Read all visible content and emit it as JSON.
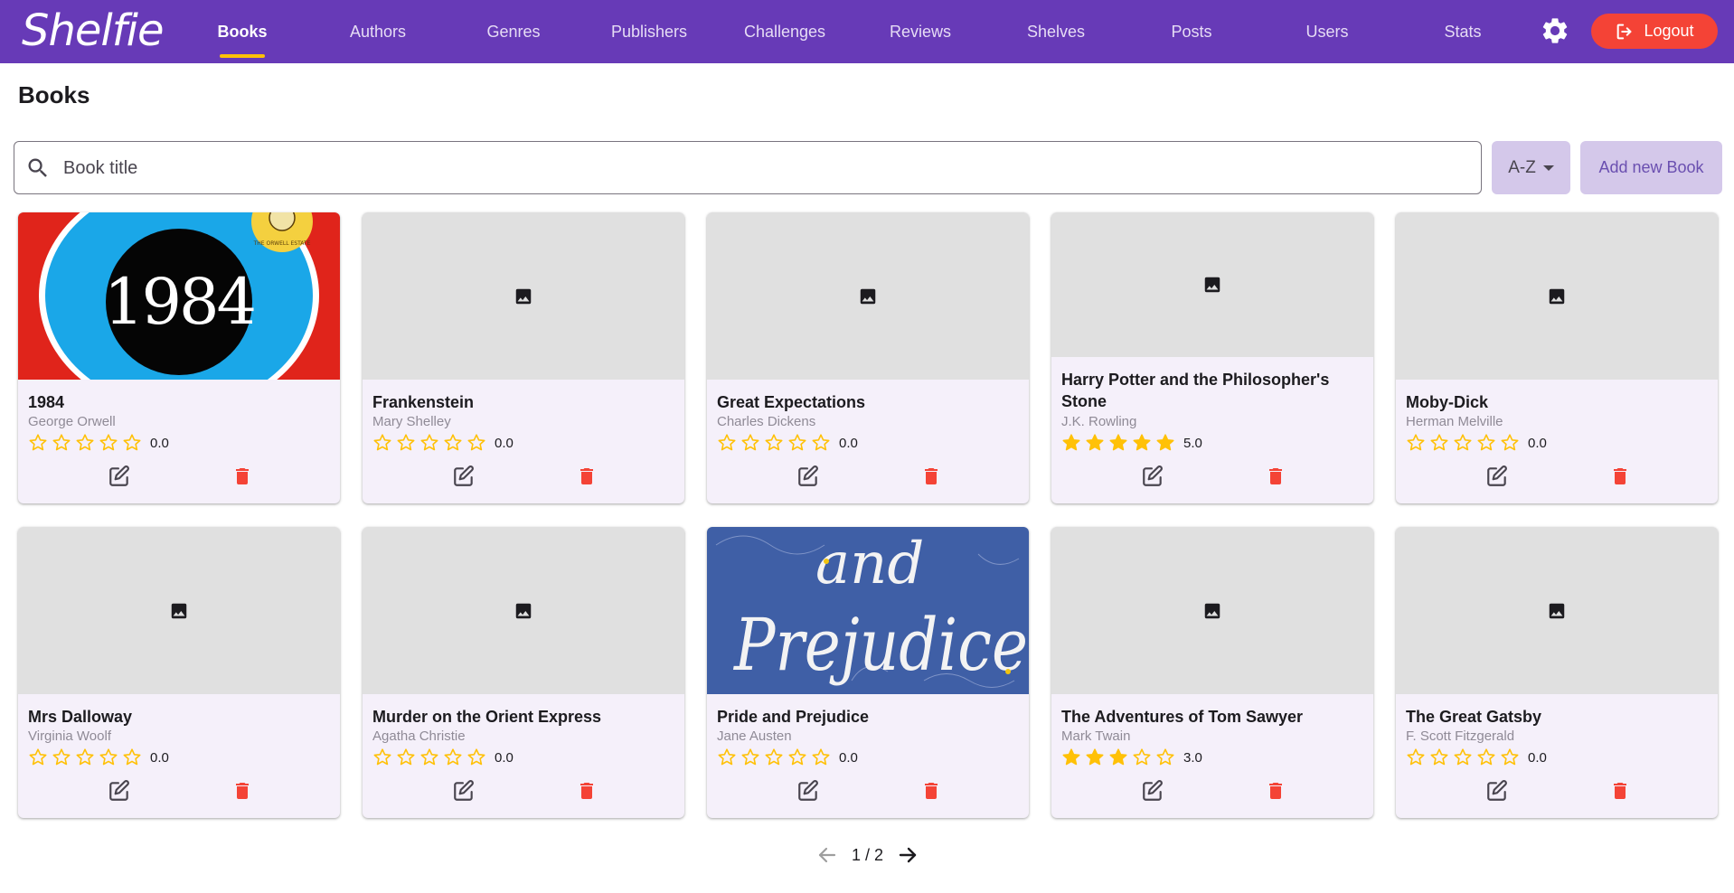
{
  "app": {
    "name": "Shelfie",
    "nav": [
      {
        "label": "Books",
        "active": true
      },
      {
        "label": "Authors",
        "active": false
      },
      {
        "label": "Genres",
        "active": false
      },
      {
        "label": "Publishers",
        "active": false
      },
      {
        "label": "Challenges",
        "active": false
      },
      {
        "label": "Reviews",
        "active": false
      },
      {
        "label": "Shelves",
        "active": false
      },
      {
        "label": "Posts",
        "active": false
      },
      {
        "label": "Users",
        "active": false
      },
      {
        "label": "Stats",
        "active": false
      }
    ],
    "settings_icon": "gear-icon",
    "logout_label": "Logout",
    "colors": {
      "primary": "#673ab7",
      "accent": "#ffc107",
      "danger": "#f44336",
      "button_tint": "#d4c8ea",
      "card_bg": "#f5f0fa"
    }
  },
  "page": {
    "title": "Books",
    "search_placeholder": "Book title",
    "search_value": "",
    "sort_label": "A-Z",
    "add_label": "Add new Book"
  },
  "books": [
    {
      "title": "1984",
      "author": "George Orwell",
      "rating": 0,
      "rating_text": "0.0",
      "cover": "1984",
      "cover_text": "1984",
      "badge_text": "THE ORWELL ESTATE"
    },
    {
      "title": "Frankenstein",
      "author": "Mary Shelley",
      "rating": 0,
      "rating_text": "0.0",
      "cover": "placeholder"
    },
    {
      "title": "Great Expectations",
      "author": "Charles Dickens",
      "rating": 0,
      "rating_text": "0.0",
      "cover": "placeholder"
    },
    {
      "title": "Harry Potter and the Philosopher's Stone",
      "author": "J.K. Rowling",
      "rating": 5,
      "rating_text": "5.0",
      "cover": "placeholder"
    },
    {
      "title": "Moby-Dick",
      "author": "Herman Melville",
      "rating": 0,
      "rating_text": "0.0",
      "cover": "placeholder"
    },
    {
      "title": "Mrs Dalloway",
      "author": "Virginia Woolf",
      "rating": 0,
      "rating_text": "0.0",
      "cover": "placeholder"
    },
    {
      "title": "Murder on the Orient Express",
      "author": "Agatha Christie",
      "rating": 0,
      "rating_text": "0.0",
      "cover": "placeholder"
    },
    {
      "title": "Pride and Prejudice",
      "author": "Jane Austen",
      "rating": 0,
      "rating_text": "0.0",
      "cover": "pride",
      "cover_line1": "and",
      "cover_line2": "Prejudice"
    },
    {
      "title": "The Adventures of Tom Sawyer",
      "author": "Mark Twain",
      "rating": 3,
      "rating_text": "3.0",
      "cover": "placeholder"
    },
    {
      "title": "The Great Gatsby",
      "author": "F. Scott Fitzgerald",
      "rating": 0,
      "rating_text": "0.0",
      "cover": "placeholder"
    }
  ],
  "pagination": {
    "current": 1,
    "total": 2,
    "text": "1 / 2"
  }
}
